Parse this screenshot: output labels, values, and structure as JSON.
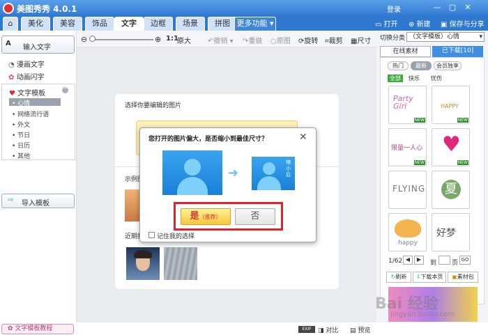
{
  "app": {
    "title": "美图秀秀 4.0.1",
    "login": "登录"
  },
  "tabs": [
    "美化",
    "美容",
    "饰品",
    "文字",
    "边框",
    "场景",
    "拼图",
    "更多功能 ▾"
  ],
  "top_actions": {
    "open": "打开",
    "new": "新建",
    "save_share": "保存与分享"
  },
  "toolbar": {
    "zoom_label": "1:1",
    "original": "原大",
    "undo": "撤销",
    "redo": "重做",
    "restore": "原图",
    "rotate": "旋转",
    "crop": "裁剪",
    "size": "尺寸"
  },
  "left": {
    "input_text": "输入文字",
    "comic_text": "漫画文字",
    "animated_text": "动画闪字",
    "text_template": "文字模板",
    "template_items": [
      "心情",
      "网络流行语",
      "外文",
      "节日",
      "日历",
      "其他"
    ],
    "import_template": "导入模板",
    "tutorial": "文字模板教程"
  },
  "card": {
    "select_prompt": "选择你要编辑的图片",
    "sample_label": "示例图",
    "recent_label": "近期打"
  },
  "dialog": {
    "question": "您打开的图片偏大，是否缩小到最佳尺寸？",
    "shrink_tag": "缩小后",
    "yes": "是",
    "yes_note": "（推荐）",
    "no": "否",
    "remember": "记住我的选择"
  },
  "right": {
    "switch_label": "切换分类",
    "category": "（文字模板）心情",
    "online_tab": "在线素材",
    "downloaded_tab": "已下载[10]",
    "filters": [
      "热门",
      "最新",
      "会员独享"
    ],
    "sub_filters": [
      "全部",
      "快乐",
      "忧伤"
    ],
    "thumbs": [
      "Party Girl",
      "HAPPY",
      "限量一人心",
      "♥",
      "FLYING",
      "夏",
      "happy",
      "好梦"
    ],
    "new_tag": "NEW",
    "page": "1/62",
    "goto": "到",
    "page_unit": "页",
    "go": "GO",
    "refresh": "刷新",
    "download_page": "下载本页",
    "material_pack": "素材包"
  },
  "status": {
    "compare": "对比",
    "preview": "预览"
  },
  "watermark": {
    "brand": "Bai 经验",
    "url": "jingyan.baidu.com"
  },
  "colors": {
    "blue": "#2f78d0",
    "yes_bg": "#ffd84a",
    "highlight": "#d9262c"
  }
}
